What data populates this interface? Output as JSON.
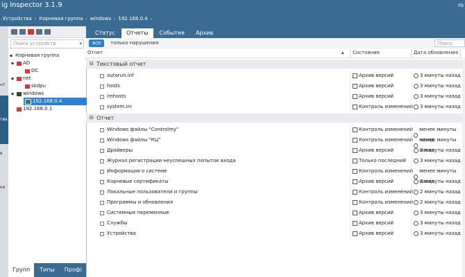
{
  "window": {
    "title": "ig Inspector 3.1.9",
    "user": "ro"
  },
  "breadcrumb": [
    "Устройства",
    "Корневая группа",
    "windows",
    "192.168.0.4"
  ],
  "left_strip": [
    "нт",
    "тва",
    "в",
    "ки"
  ],
  "tree_search_placeholder": "Поиск устройств",
  "tree": [
    {
      "label": "Корневая группа",
      "level": 0,
      "icon": "root",
      "expanded": true
    },
    {
      "label": "AD",
      "level": 1,
      "icon": "folder",
      "expanded": true
    },
    {
      "label": "DC",
      "level": 2,
      "icon": "device-error"
    },
    {
      "label": "net",
      "level": 1,
      "icon": "folder",
      "expanded": true
    },
    {
      "label": "skdpu",
      "level": 2,
      "icon": "device-error"
    },
    {
      "label": "windows",
      "level": 1,
      "icon": "folder",
      "expanded": true
    },
    {
      "label": "192.168.0.4",
      "level": 2,
      "icon": "device",
      "selected": true
    },
    {
      "label": "192.168.0.1",
      "level": 1,
      "icon": "device-error"
    }
  ],
  "bottom_tabs": [
    "Групп",
    "Типы",
    "Профі"
  ],
  "tabs": [
    "Статус",
    "Отчеты",
    "События",
    "Архив"
  ],
  "active_tab": 1,
  "filters": {
    "all": "все",
    "violations": "только нарушения",
    "search_placeholder": "Поиск"
  },
  "columns": [
    "Отчет",
    "Состояние",
    "Дата обновления"
  ],
  "groups": [
    {
      "title": "Текстовый отчет",
      "rows": [
        {
          "name": "autorun.inf",
          "status": "Архив версий",
          "date": "3 минуты назад"
        },
        {
          "name": "hosts",
          "status": "Архив версий",
          "date": "3 минуты назад"
        },
        {
          "name": "lmhosts",
          "status": "Архив версий",
          "date": "3 минуты назад"
        },
        {
          "name": "system.ini",
          "status": "Контроль изменений",
          "date": "3 минуты назад"
        }
      ]
    },
    {
      "title": "Отчет",
      "rows": [
        {
          "name": "Windows файлы \"Controlmy\"",
          "status": "Контроль изменений",
          "date": "менее минуты назад"
        },
        {
          "name": "Windows файлы \"КЦ\"",
          "status": "Контроль изменений",
          "date": "менее минуты назад"
        },
        {
          "name": "Драйверы",
          "status": "Архив версий",
          "date": "3 минуты назад"
        },
        {
          "name": "Журнал регистрации неуспешных попыток входа",
          "status": "Только последний",
          "date": "3 минуты назад"
        },
        {
          "name": "Информация о системе",
          "status": "Контроль изменений",
          "date": "менее минуты назад"
        },
        {
          "name": "Корневые сертификаты",
          "status": "Архив версий",
          "date": "3 минуты назад"
        },
        {
          "name": "Локальные пользователи и группы",
          "status": "Контроль изменений",
          "date": "2 минуты назад"
        },
        {
          "name": "Программы и обновления",
          "status": "Контроль изменений",
          "date": "2 минуты назад"
        },
        {
          "name": "Системные переменные",
          "status": "Архив версий",
          "date": "3 минуты назад"
        },
        {
          "name": "Службы",
          "status": "Архив версий",
          "date": "3 минуты назад"
        },
        {
          "name": "Устройства",
          "status": "Архив версий",
          "date": "3 минуты назад"
        }
      ]
    }
  ]
}
